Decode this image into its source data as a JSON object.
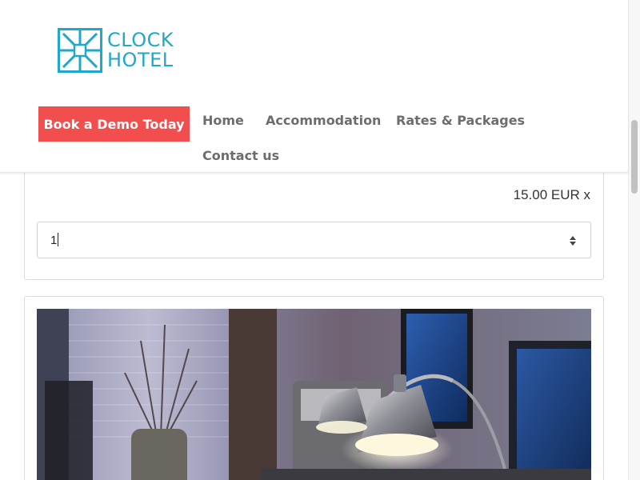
{
  "brand": {
    "line1": "CLOCK",
    "line2": "HOTEL",
    "color": "#1fa8c9"
  },
  "header": {
    "cta_label": "Book a Demo Today",
    "cta_color": "#f24e4e",
    "nav": [
      {
        "label": "Home"
      },
      {
        "label": "Accommodation"
      },
      {
        "label": "Rates & Packages"
      },
      {
        "label": "Contact us"
      }
    ]
  },
  "extra": {
    "price_text": "15.00 EUR x",
    "quantity_value": "1"
  },
  "photo": {
    "subject": "desk-lamp-workspace"
  }
}
